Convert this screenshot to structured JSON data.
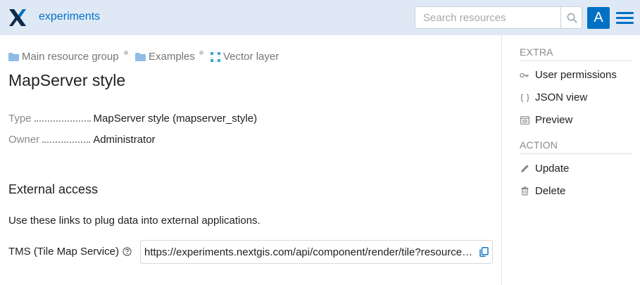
{
  "header": {
    "app_name": "experiments",
    "search_placeholder": "Search resources",
    "avatar_letter": "A",
    "brand_color": "#0070c5",
    "background_color": "#dfe9f5"
  },
  "breadcrumb": [
    {
      "label": "Main resource group",
      "icon": "folder-icon"
    },
    {
      "label": "Examples",
      "icon": "folder-icon"
    },
    {
      "label": "Vector layer",
      "icon": "vector-layer-icon"
    }
  ],
  "page": {
    "title": "MapServer style",
    "fields": [
      {
        "key": "Type",
        "value": "MapServer style (mapserver_style)"
      },
      {
        "key": "Owner",
        "value": "Administrator"
      }
    ],
    "external_access": {
      "title": "External access",
      "description": "Use these links to plug data into external applications.",
      "tms_label": "TMS (Tile Map Service)",
      "tms_url": "https://experiments.nextgis.com/api/component/render/tile?resource=..."
    }
  },
  "sidebar": {
    "extra_heading": "EXTRA",
    "extra_items": [
      {
        "label": "User permissions",
        "icon": "key-icon"
      },
      {
        "label": "JSON view",
        "icon": "braces-icon"
      },
      {
        "label": "Preview",
        "icon": "preview-icon"
      }
    ],
    "action_heading": "ACTION",
    "action_items": [
      {
        "label": "Update",
        "icon": "pencil-icon"
      },
      {
        "label": "Delete",
        "icon": "trash-icon"
      }
    ]
  }
}
